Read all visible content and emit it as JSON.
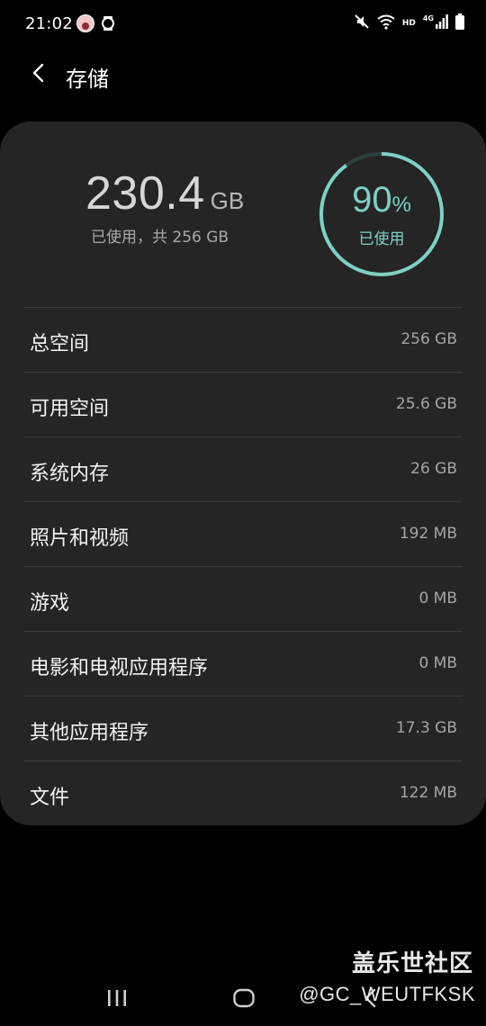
{
  "status_bar": {
    "time": "21:02",
    "hd_label": "HD",
    "network_label": "4G"
  },
  "header": {
    "title": "存储",
    "back_icon": "chevron-left-icon"
  },
  "summary": {
    "used_value": "230.4",
    "used_unit": "GB",
    "used_caption": "已使用，共 256 GB",
    "percent_value": "90",
    "percent_sign": "%",
    "percent_used_fraction": 0.9,
    "percent_label": "已使用",
    "accent_color": "#7fd0c4"
  },
  "rows": [
    {
      "label": "总空间",
      "value": "256 GB"
    },
    {
      "label": "可用空间",
      "value": "25.6 GB"
    },
    {
      "label": "系统内存",
      "value": "26 GB"
    },
    {
      "label": "照片和视频",
      "value": "192 MB"
    },
    {
      "label": "游戏",
      "value": "0 MB"
    },
    {
      "label": "电影和电视应用程序",
      "value": "0 MB"
    },
    {
      "label": "其他应用程序",
      "value": "17.3 GB"
    },
    {
      "label": "文件",
      "value": "122 MB"
    }
  ],
  "watermark": {
    "title": "盖乐世社区",
    "handle": "@GC_WEUTFKSK"
  },
  "nav_bar": {
    "recent_icon": "recent-apps-icon",
    "home_icon": "home-icon",
    "back_icon": "back-icon"
  }
}
